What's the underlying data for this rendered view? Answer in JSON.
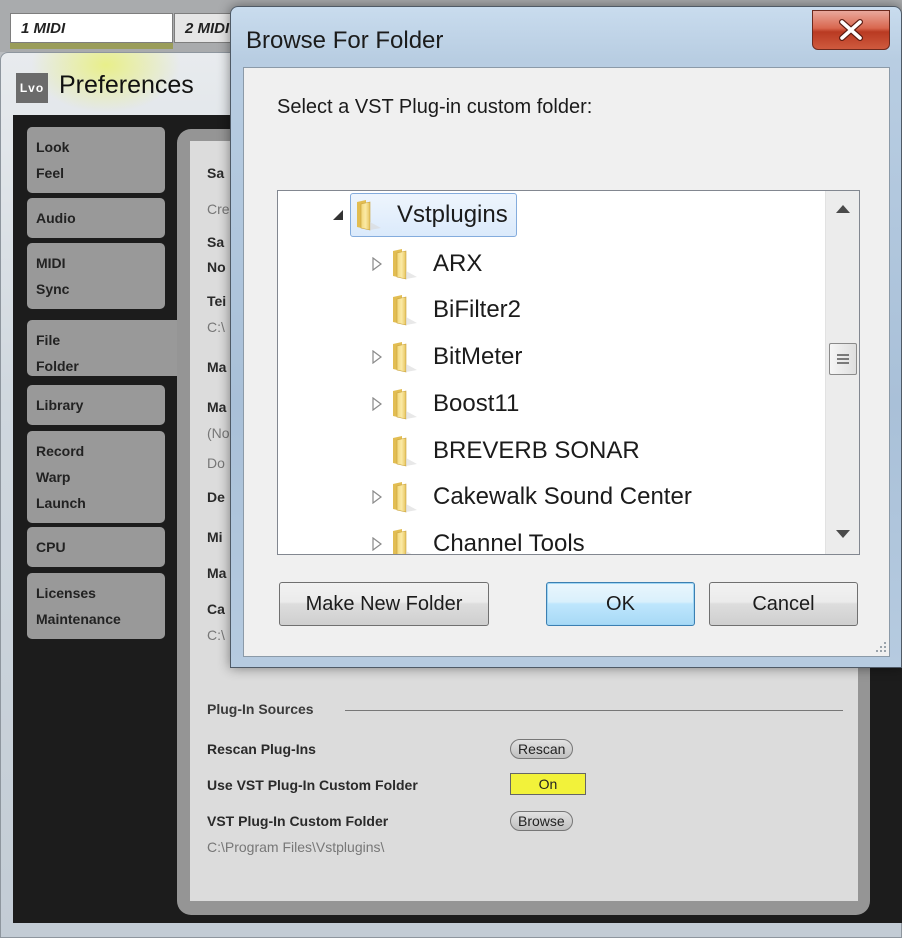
{
  "tracks": [
    {
      "label": "1 MIDI"
    },
    {
      "label": "2 MIDI"
    }
  ],
  "preferences": {
    "logo": "Lvo",
    "title": "Preferences",
    "nav": [
      {
        "lines": [
          "Look",
          "Feel"
        ]
      },
      {
        "lines": [
          "Audio"
        ]
      },
      {
        "lines": [
          "MIDI",
          "Sync"
        ]
      },
      {
        "lines": [
          "File",
          "Folder"
        ],
        "active": true
      },
      {
        "lines": [
          "Library"
        ]
      },
      {
        "lines": [
          "Record",
          "Warp",
          "Launch"
        ]
      },
      {
        "lines": [
          "CPU"
        ]
      },
      {
        "lines": [
          "Licenses",
          "Maintenance"
        ]
      }
    ],
    "hidden_rows_partial": [
      "Sa",
      "Cre",
      "Sa",
      "No",
      "Tei",
      "C:\\",
      "Ma",
      "Ma",
      "(No",
      "Do",
      "De",
      "Mi",
      "Ma",
      "Ca",
      "C:\\"
    ],
    "plugin_sources": {
      "section_title": "Plug-In Sources",
      "rescan_label": "Rescan Plug-Ins",
      "rescan_button": "Rescan",
      "use_custom_label": "Use VST Plug-In Custom Folder",
      "use_custom_value": "On",
      "custom_folder_label": "VST Plug-In Custom Folder",
      "browse_button": "Browse",
      "custom_folder_path": "C:\\Program Files\\Vstplugins\\"
    },
    "colors": {
      "toggle_on": "#f2f23a",
      "panel_bg": "#dcdcdc",
      "frame": "#1c1c1c"
    }
  },
  "dialog": {
    "title": "Browse For Folder",
    "close_icon": "close-icon",
    "prompt": "Select a VST Plug-in custom folder:",
    "tree": [
      {
        "label": "Vstplugins",
        "level": 0,
        "expander": "expanded",
        "selected": true
      },
      {
        "label": "ARX",
        "level": 1,
        "expander": "collapsed"
      },
      {
        "label": "BiFilter2",
        "level": 1,
        "expander": "none"
      },
      {
        "label": "BitMeter",
        "level": 1,
        "expander": "collapsed"
      },
      {
        "label": "Boost11",
        "level": 1,
        "expander": "collapsed"
      },
      {
        "label": "BREVERB SONAR",
        "level": 1,
        "expander": "none"
      },
      {
        "label": "Cakewalk Sound Center",
        "level": 1,
        "expander": "collapsed"
      },
      {
        "label": "Channel Tools",
        "level": 1,
        "expander": "collapsed"
      }
    ],
    "buttons": {
      "make_new_folder": "Make New Folder",
      "ok": "OK",
      "cancel": "Cancel"
    }
  }
}
